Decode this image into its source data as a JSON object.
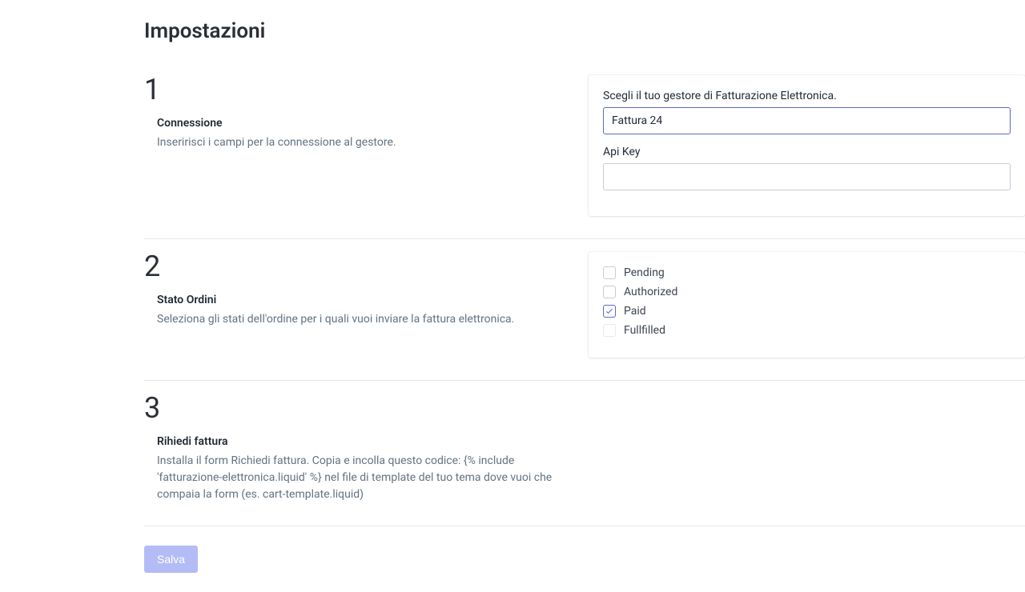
{
  "page": {
    "title": "Impostazioni"
  },
  "section1": {
    "number": "1",
    "heading": "Connessione",
    "description": "Inseririsci i campi per la connessione al gestore.",
    "provider_label": "Scegli il tuo gestore di Fatturazione Elettronica.",
    "provider_value": "Fattura 24",
    "apikey_label": "Api Key",
    "apikey_value": ""
  },
  "section2": {
    "number": "2",
    "heading": "Stato Ordini",
    "description": "Seleziona gli stati dell'ordine per i quali vuoi inviare la fattura elettronica.",
    "statuses": {
      "pending": {
        "label": "Pending",
        "checked": false,
        "disabled": false
      },
      "authorized": {
        "label": "Authorized",
        "checked": false,
        "disabled": false
      },
      "paid": {
        "label": "Paid",
        "checked": true,
        "disabled": false
      },
      "fulfilled": {
        "label": "Fullfilled",
        "checked": false,
        "disabled": true
      }
    }
  },
  "section3": {
    "number": "3",
    "heading": "Rihiedi fattura",
    "description": "Installa il form Richiedi fattura. Copia e incolla questo codice: {% include 'fatturazione-elettronica.liquid' %} nel file di template del tuo tema dove vuoi che compaia la form (es. cart-template.liquid)"
  },
  "actions": {
    "save_label": "Salva"
  }
}
